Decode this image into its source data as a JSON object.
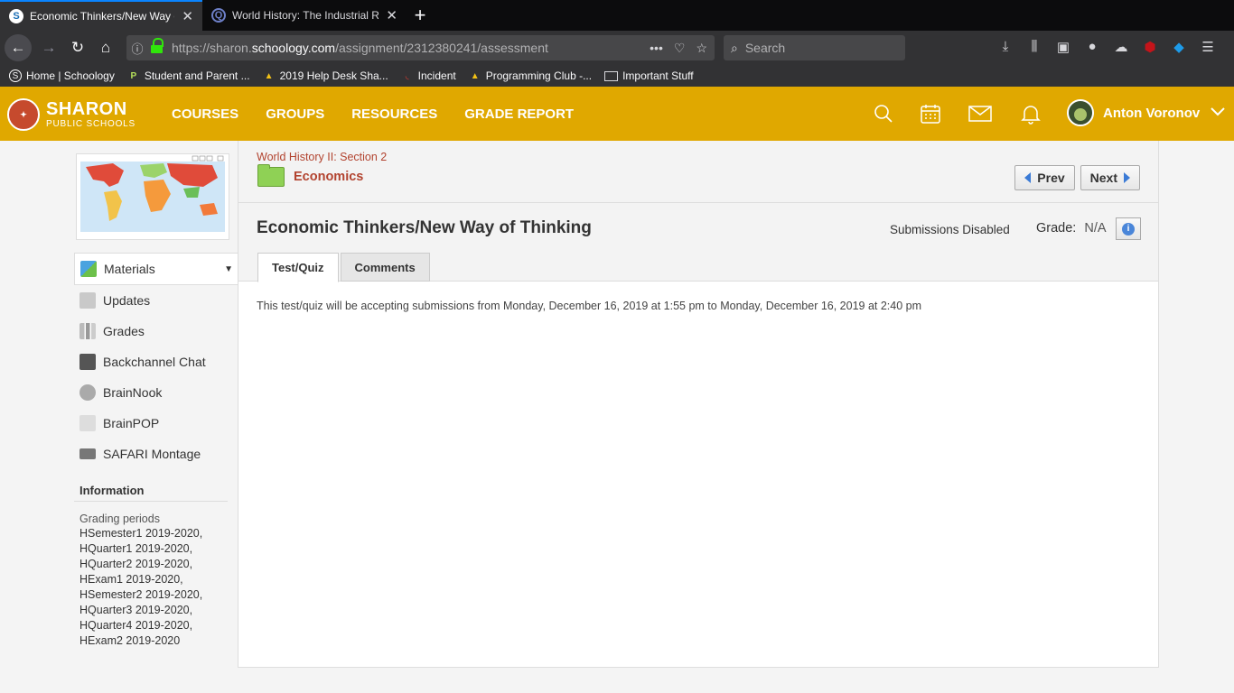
{
  "browser": {
    "tabs": [
      {
        "title": "Economic Thinkers/New Way of Thinking",
        "favicon": "S",
        "active": true
      },
      {
        "title": "World History: The Industrial Revolution",
        "favicon": "Q",
        "active": false
      }
    ],
    "url_prefix": "https://sharon.",
    "url_host": "schoology.com",
    "url_path": "/assignment/2312380241/assessment",
    "search_placeholder": "Search",
    "bookmarks": [
      {
        "label": "Home | Schoology",
        "icon": "schoology-icon"
      },
      {
        "label": "Student and Parent ...",
        "icon": "parentsquare-icon"
      },
      {
        "label": "2019 Help Desk Sha...",
        "icon": "drive-icon"
      },
      {
        "label": "Incident",
        "icon": "incident-icon"
      },
      {
        "label": "Programming Club -...",
        "icon": "drive-icon"
      },
      {
        "label": "Important Stuff",
        "icon": "folder-icon"
      }
    ]
  },
  "header": {
    "logo_line1": "SHARON",
    "logo_line2": "PUBLIC SCHOOLS",
    "nav": [
      "COURSES",
      "GROUPS",
      "RESOURCES",
      "GRADE REPORT"
    ],
    "user_name": "Anton Voronov",
    "brand_color": "#e0a800"
  },
  "sidebar": {
    "menu": [
      {
        "label": "Materials",
        "icon": "materials-icon",
        "active": true
      },
      {
        "label": "Updates",
        "icon": "updates-icon"
      },
      {
        "label": "Grades",
        "icon": "grades-icon"
      },
      {
        "label": "Backchannel Chat",
        "icon": "chat-icon"
      },
      {
        "label": "BrainNook",
        "icon": "brainnook-icon"
      },
      {
        "label": "BrainPOP",
        "icon": "brainpop-icon"
      },
      {
        "label": "SAFARI Montage",
        "icon": "safari-montage-icon"
      }
    ],
    "info_heading": "Information",
    "grading_label": "Grading periods",
    "grading_periods": [
      "HSemester1 2019-2020,",
      "HQuarter1 2019-2020,",
      "HQuarter2 2019-2020,",
      "HExam1 2019-2020,",
      "HSemester2 2019-2020,",
      "HQuarter3 2019-2020,",
      "HQuarter4 2019-2020,",
      "HExam2 2019-2020"
    ]
  },
  "main": {
    "breadcrumb": "World History II: Section 2",
    "folder_name": "Economics",
    "prev_label": "Prev",
    "next_label": "Next",
    "title": "Economic Thinkers/New Way of Thinking",
    "submissions_status": "Submissions Disabled",
    "grade_label": "Grade:",
    "grade_value": "N/A",
    "tabs": [
      "Test/Quiz",
      "Comments"
    ],
    "notice": "This test/quiz will be accepting submissions from Monday, December 16, 2019 at 1:55 pm to Monday, December 16, 2019 at 2:40 pm"
  }
}
